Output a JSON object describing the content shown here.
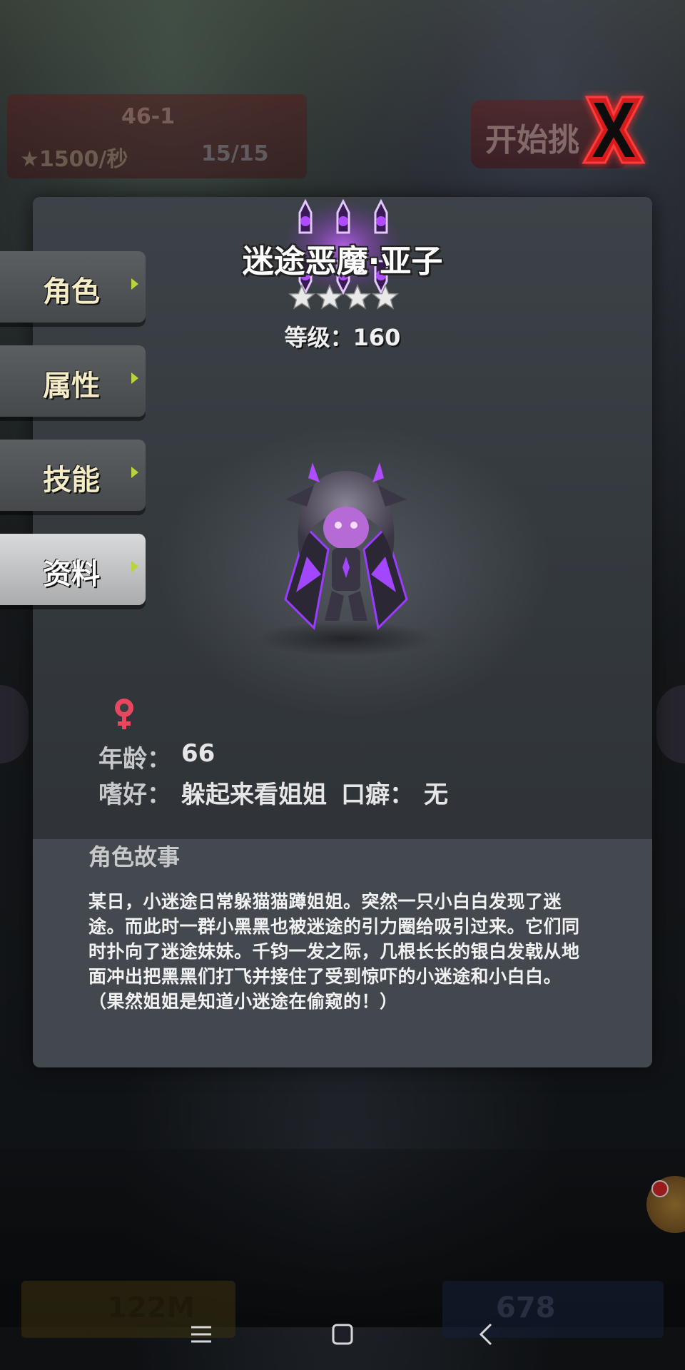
{
  "stage": {
    "title": "46-1",
    "rate": "★1500/秒",
    "count": "15/15",
    "start_button": "开始挑"
  },
  "tabs": [
    {
      "label": "角色",
      "active": false
    },
    {
      "label": "属性",
      "active": false
    },
    {
      "label": "技能",
      "active": false
    },
    {
      "label": "资料",
      "active": true
    }
  ],
  "character": {
    "name": "迷途恶魔·亚子",
    "stars": 4,
    "level_label": "等级：",
    "level_value": "160",
    "gender": "female",
    "age_label": "年龄：",
    "age_value": "66",
    "hobby_label": "嗜好：",
    "hobby_value": "躲起来看姐姐",
    "catchphrase_label": "口癖：",
    "catchphrase_value": "无"
  },
  "story": {
    "title": "角色故事",
    "text": "某日，小迷途日常躲猫猫蹲姐姐。突然一只小白白发现了迷途。而此时一群小黑黑也被迷途的引力圈给吸引过来。它们同时扑向了迷途妹妹。千钧一发之际，几根长长的银白发戟从地面冲出把黑黑们打飞并接住了受到惊吓的小迷途和小白白。（果然姐姐是知道小迷途在偷窥的！）"
  },
  "bottom": {
    "gold": "122M",
    "gems": "678"
  },
  "colors": {
    "accent_purple": "#b04cff",
    "tab_text": "#f4ecc6",
    "close_red": "#e01818"
  },
  "icons": [
    "close-icon",
    "star-icon",
    "female-icon",
    "chest-icon",
    "menu-icon",
    "home-icon",
    "back-icon"
  ]
}
